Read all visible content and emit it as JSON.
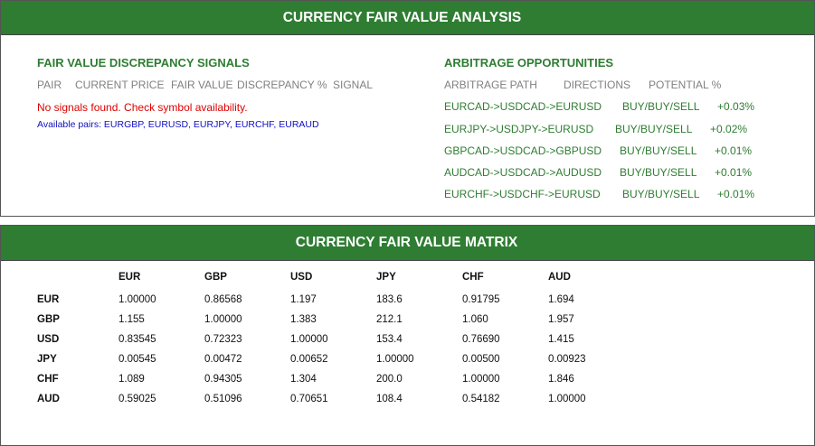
{
  "analysis": {
    "title": "CURRENCY FAIR VALUE ANALYSIS",
    "signals": {
      "title": "FAIR VALUE DISCREPANCY SIGNALS",
      "columns": [
        "PAIR",
        "CURRENT PRICE",
        "FAIR VALUE",
        "DISCREPANCY %",
        "SIGNAL"
      ],
      "message": "No signals found. Check symbol availability.",
      "available_pairs": "Available pairs: EURGBP, EURUSD, EURJPY, EURCHF, EURAUD"
    },
    "arbitrage": {
      "title": "ARBITRAGE OPPORTUNITIES",
      "columns": [
        "ARBITRAGE PATH",
        "DIRECTIONS",
        "POTENTIAL %"
      ],
      "rows": [
        {
          "path": "EURCAD->USDCAD->EURUSD",
          "directions": "BUY/BUY/SELL",
          "potential": "+0.03%"
        },
        {
          "path": "EURJPY->USDJPY->EURUSD",
          "directions": "BUY/BUY/SELL",
          "potential": "+0.02%"
        },
        {
          "path": "GBPCAD->USDCAD->GBPUSD",
          "directions": "BUY/BUY/SELL",
          "potential": "+0.01%"
        },
        {
          "path": "AUDCAD->USDCAD->AUDUSD",
          "directions": "BUY/BUY/SELL",
          "potential": "+0.01%"
        },
        {
          "path": "EURCHF->USDCHF->EURUSD",
          "directions": "BUY/BUY/SELL",
          "potential": "+0.01%"
        }
      ]
    }
  },
  "matrix": {
    "title": "CURRENCY FAIR VALUE MATRIX",
    "columns": [
      "EUR",
      "GBP",
      "USD",
      "JPY",
      "CHF",
      "AUD"
    ],
    "rows": [
      {
        "label": "EUR",
        "values": [
          "1.00000",
          "0.86568",
          "1.197",
          "183.6",
          "0.91795",
          "1.694"
        ]
      },
      {
        "label": "GBP",
        "values": [
          "1.155",
          "1.00000",
          "1.383",
          "212.1",
          "1.060",
          "1.957"
        ]
      },
      {
        "label": "USD",
        "values": [
          "0.83545",
          "0.72323",
          "1.00000",
          "153.4",
          "0.76690",
          "1.415"
        ]
      },
      {
        "label": "JPY",
        "values": [
          "0.00545",
          "0.00472",
          "0.00652",
          "1.00000",
          "0.00500",
          "0.00923"
        ]
      },
      {
        "label": "CHF",
        "values": [
          "1.089",
          "0.94305",
          "1.304",
          "200.0",
          "1.00000",
          "1.846"
        ]
      },
      {
        "label": "AUD",
        "values": [
          "0.59025",
          "0.51096",
          "0.70651",
          "108.4",
          "0.54182",
          "1.00000"
        ]
      }
    ]
  },
  "colors": {
    "header_bg": "#2e7d32",
    "section_title": "#2e7d32",
    "error_text": "#e00000",
    "info_text": "#1010c0"
  }
}
